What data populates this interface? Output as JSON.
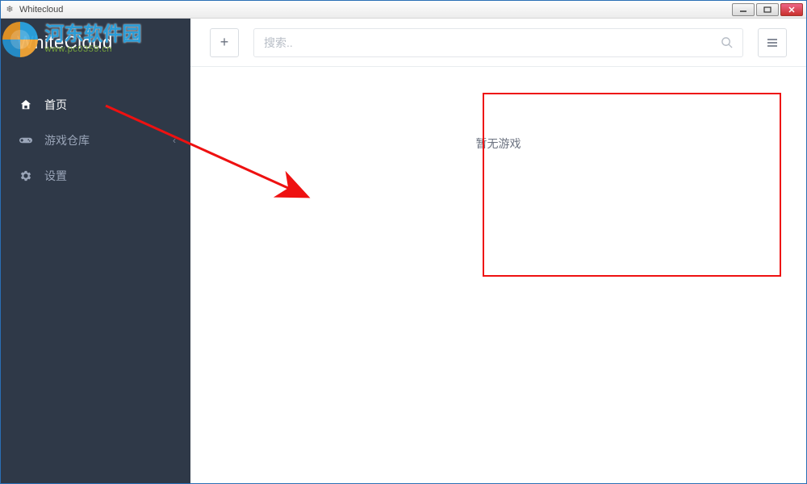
{
  "window": {
    "title": "Whitecloud"
  },
  "brand": {
    "name": "WhiteCloud"
  },
  "sidebar": {
    "items": [
      {
        "label": "首页",
        "icon": "home"
      },
      {
        "label": "游戏仓库",
        "icon": "gamepad",
        "expandable": true
      },
      {
        "label": "设置",
        "icon": "gear"
      }
    ]
  },
  "toolbar": {
    "add_label": "+",
    "search_placeholder": "搜索..",
    "search_value": ""
  },
  "content": {
    "empty_message": "暂无游戏"
  },
  "watermark": {
    "text": "河东软件园",
    "url": "www.pc0359.cn"
  }
}
